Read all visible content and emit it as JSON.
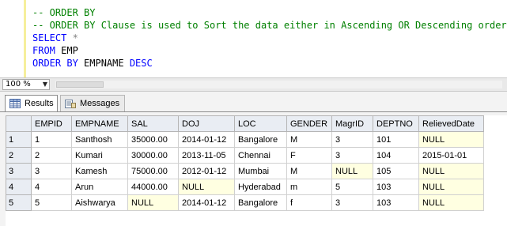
{
  "editor": {
    "lines": [
      {
        "parts": [
          {
            "t": "cm",
            "v": "-- ORDER BY"
          }
        ]
      },
      {
        "parts": [
          {
            "t": "cm",
            "v": "-- ORDER BY Clause is used to Sort the data either in Ascending OR Descending order"
          }
        ]
      },
      {
        "parts": [
          {
            "t": "kw",
            "v": "SELECT"
          },
          {
            "t": "tx",
            "v": " "
          },
          {
            "t": "op",
            "v": "*"
          }
        ]
      },
      {
        "parts": [
          {
            "t": "kw",
            "v": "FROM"
          },
          {
            "t": "tx",
            "v": " EMP"
          }
        ]
      },
      {
        "parts": [
          {
            "t": "kw",
            "v": "ORDER BY"
          },
          {
            "t": "tx",
            "v": " EMPNAME "
          },
          {
            "t": "kw",
            "v": "DESC"
          }
        ]
      }
    ]
  },
  "zoom": {
    "value": "100 %"
  },
  "tabs": [
    {
      "label": "Results",
      "icon": "grid-icon",
      "active": true
    },
    {
      "label": "Messages",
      "icon": "messages-icon",
      "active": false
    }
  ],
  "grid": {
    "columns": [
      "EMPID",
      "EMPNAME",
      "SAL",
      "DOJ",
      "LOC",
      "GENDER",
      "MagrID",
      "DEPTNO",
      "RelievedDate"
    ],
    "rows": [
      {
        "num": "1",
        "cells": [
          "1",
          "Santhosh",
          "35000.00",
          "2014-01-12",
          "Bangalore",
          "M",
          "3",
          "101",
          "NULL"
        ]
      },
      {
        "num": "2",
        "cells": [
          "2",
          "Kumari",
          "30000.00",
          "2013-11-05",
          "Chennai",
          "F",
          "3",
          "104",
          "2015-01-01"
        ]
      },
      {
        "num": "3",
        "cells": [
          "3",
          "Kamesh",
          "75000.00",
          "2012-01-12",
          "Mumbai",
          "M",
          "NULL",
          "105",
          "NULL"
        ]
      },
      {
        "num": "4",
        "cells": [
          "4",
          "Arun",
          "44000.00",
          "NULL",
          "Hyderabad",
          "m",
          "5",
          "103",
          "NULL"
        ]
      },
      {
        "num": "5",
        "cells": [
          "5",
          "Aishwarya",
          "NULL",
          "2014-01-12",
          "Bangalore",
          "f",
          "3",
          "103",
          "NULL"
        ]
      }
    ]
  }
}
